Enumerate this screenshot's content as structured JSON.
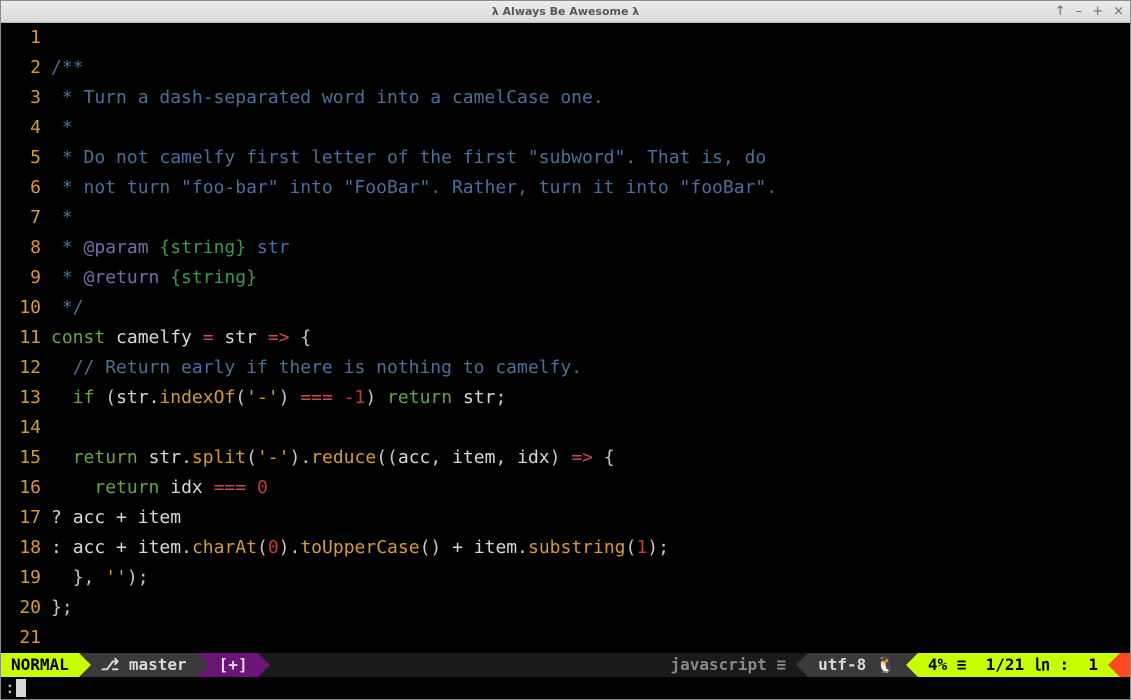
{
  "window": {
    "title": "λ Always Be Awesome λ"
  },
  "controls": {
    "up": "↑",
    "min": "–",
    "max": "+",
    "close": "×"
  },
  "editor": {
    "line_count": 21,
    "lines": [
      "",
      "/**",
      " * Turn a dash-separated word into a camelCase one.",
      " *",
      " * Do not camelfy first letter of the first \"subword\". That is, do",
      " * not turn \"foo-bar\" into \"FooBar\". Rather, turn it into \"fooBar\".",
      " *",
      " * @param {string} str",
      " * @return {string}",
      " */",
      "const camelfy = str => {",
      "  // Return early if there is nothing to camelfy.",
      "  if (str.indexOf('-') === -1) return str;",
      "",
      "  return str.split('-').reduce((acc, item, idx) => {",
      "    return idx === 0",
      "      ? acc + item",
      "      : acc + item.charAt(0).toUpperCase() + item.substring(1);",
      "  }, '');",
      "};",
      ""
    ]
  },
  "statusline": {
    "mode": "NORMAL",
    "branch_icon": "⎇",
    "branch": "master",
    "modified": "[+]",
    "filetype": "javascript",
    "ft_icon": "≡",
    "encoding": "utf-8",
    "os_icon": "🐧",
    "percent": "4%",
    "percent_icon": "≡",
    "lineinfo": "1/21",
    "ln_icon": "㏑",
    "col_sep": ":",
    "col": "1"
  },
  "cmdline": {
    "prompt": ":"
  }
}
